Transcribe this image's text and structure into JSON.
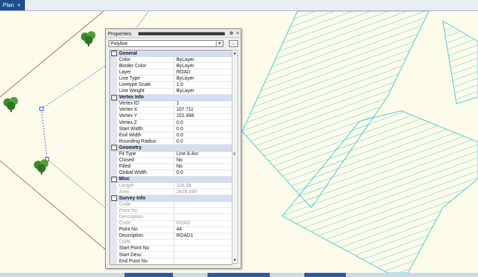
{
  "tab": {
    "label": "Plan",
    "close_glyph": "×"
  },
  "panel": {
    "title": "Properties",
    "pin_glyph": "⊕",
    "close_glyph": "×",
    "object_type": "Polyline",
    "quick_select_label": "..."
  },
  "categories": [
    {
      "name": "General",
      "rows": [
        {
          "name": "Color",
          "value": "ByLayer"
        },
        {
          "name": "Border Color",
          "value": "ByLayer"
        },
        {
          "name": "Layer",
          "value": "ROAD"
        },
        {
          "name": "Line Type",
          "value": "ByLayer"
        },
        {
          "name": "Linetype Scale",
          "value": "1.0"
        },
        {
          "name": "Line Weight",
          "value": "ByLayer"
        }
      ]
    },
    {
      "name": "Vertex Info",
      "rows": [
        {
          "name": "Vertex ID",
          "value": "1"
        },
        {
          "name": "Vertex X",
          "value": "107.711"
        },
        {
          "name": "Vertex Y",
          "value": "101.498"
        },
        {
          "name": "Vertex Z",
          "value": "0.0"
        },
        {
          "name": "Start Width",
          "value": "0.0"
        },
        {
          "name": "End Width",
          "value": "0.0"
        },
        {
          "name": "Rounding Radius",
          "value": "0.0"
        }
      ]
    },
    {
      "name": "Geometry",
      "rows": [
        {
          "name": "Fit Type",
          "value": "Line & Arc"
        },
        {
          "name": "Closed",
          "value": "No"
        },
        {
          "name": "Filled",
          "value": "No"
        },
        {
          "name": "Global Width",
          "value": "0.0"
        }
      ]
    },
    {
      "name": "Misc",
      "rows": [
        {
          "name": "Length",
          "value": "326.38",
          "disabled": true
        },
        {
          "name": "Area",
          "value": "2828.589",
          "disabled": true
        }
      ]
    },
    {
      "name": "Survey Info",
      "rows": [
        {
          "name": "Code",
          "value": "",
          "disabled": true
        },
        {
          "name": "Point No",
          "value": "",
          "disabled": true
        },
        {
          "name": "Description",
          "value": "",
          "disabled": true
        },
        {
          "name": "Code",
          "value": "ROAD",
          "disabled": true
        },
        {
          "name": "Point No",
          "value": "44"
        },
        {
          "name": "Description",
          "value": "ROAD1"
        },
        {
          "name": "Code",
          "value": "",
          "disabled": true
        },
        {
          "name": "Start Point No",
          "value": ""
        },
        {
          "name": "Start Desc",
          "value": ""
        },
        {
          "name": "End Point No",
          "value": ""
        }
      ]
    }
  ],
  "colors": {
    "canvas_bg": "#fdfbe9",
    "hatch": "#49c9d6",
    "boundary": "#b5666a",
    "selected_polyline": "#3a52d8",
    "tree_green": "#3d8a2c"
  }
}
